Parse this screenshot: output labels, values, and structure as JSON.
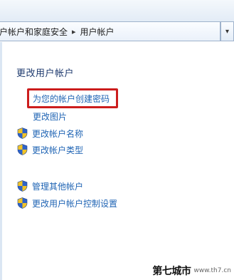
{
  "breadcrumb": {
    "part1": "户帐户和家庭安全",
    "separator": "▸",
    "part2": "用户帐户",
    "chevron": "▾"
  },
  "main": {
    "section_title": "更改用户帐户",
    "tasks": [
      {
        "label": "为您的帐户创建密码",
        "icon": "none",
        "highlighted": true
      },
      {
        "label": "更改图片",
        "icon": "none"
      },
      {
        "label": "更改帐户名称",
        "icon": "uac-shield-icon"
      },
      {
        "label": "更改帐户类型",
        "icon": "uac-shield-icon"
      },
      {
        "label": "管理其他帐户",
        "icon": "uac-shield-icon"
      },
      {
        "label": "更改用户帐户控制设置",
        "icon": "uac-shield-icon"
      }
    ]
  },
  "watermark": {
    "text": "第七城市",
    "url": "www.th7.cn"
  },
  "colors": {
    "link": "#1f64b4",
    "title": "#1e3a6e",
    "highlight": "#cc1d1d"
  }
}
